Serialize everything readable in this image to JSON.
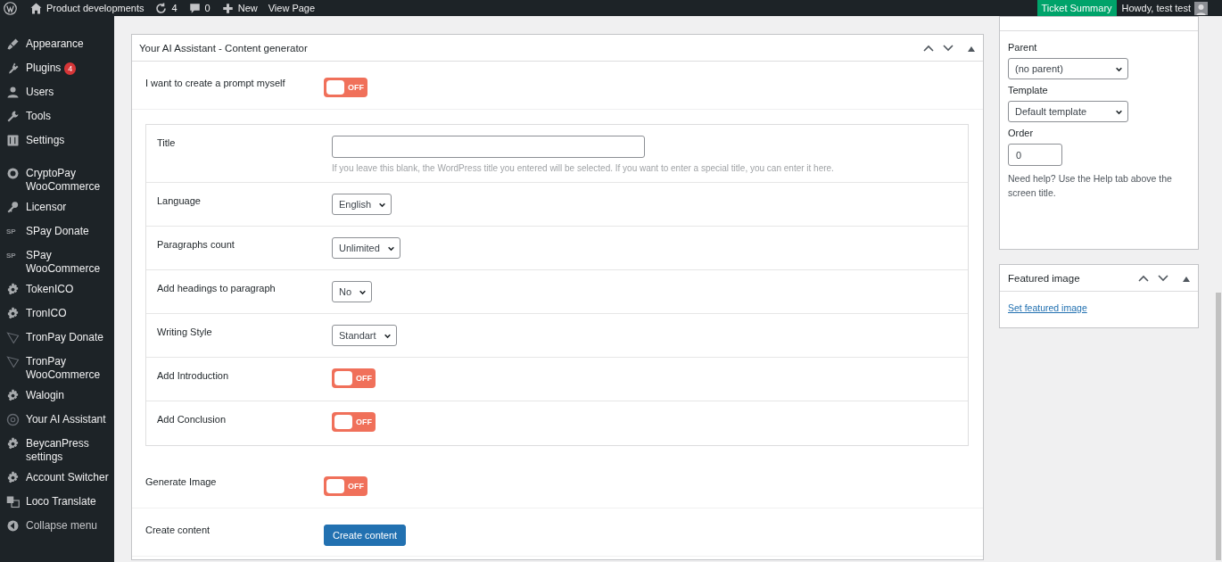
{
  "admin_bar": {
    "site": "Product developments",
    "updates": "4",
    "comments": "0",
    "new": "New",
    "view": "View Page",
    "ticket": "Ticket Summary",
    "howdy": "Howdy, test test"
  },
  "sidebar": {
    "items": [
      {
        "label": "Appearance"
      },
      {
        "label": "Plugins",
        "badge": "4"
      },
      {
        "label": "Users"
      },
      {
        "label": "Tools"
      },
      {
        "label": "Settings"
      },
      {
        "label": "CryptoPay WooCommerce"
      },
      {
        "label": "Licensor"
      },
      {
        "label": "SPay Donate",
        "icon_text": "SP"
      },
      {
        "label": "SPay WooCommerce",
        "icon_text": "SP"
      },
      {
        "label": "TokenICO"
      },
      {
        "label": "TronICO"
      },
      {
        "label": "TronPay Donate"
      },
      {
        "label": "TronPay WooCommerce"
      },
      {
        "label": "Walogin"
      },
      {
        "label": "Your AI Assistant"
      },
      {
        "label": "BeycanPress settings"
      },
      {
        "label": "Account Switcher"
      },
      {
        "label": "Loco Translate"
      }
    ],
    "collapse": "Collapse menu"
  },
  "generator": {
    "title": "Your AI Assistant - Content generator",
    "prompt_row": {
      "label": "I want to create a prompt myself",
      "kind": "toggle",
      "on": false,
      "toggle_label": "OFF"
    },
    "fields": [
      {
        "label": "Title",
        "kind": "text",
        "hint": "If you leave this blank, the WordPress title you entered will be selected. If you want to enter a special title, you can enter it here."
      },
      {
        "label": "Language",
        "kind": "select",
        "value": "English"
      },
      {
        "label": "Paragraphs count",
        "kind": "select",
        "value": "Unlimited"
      },
      {
        "label": "Add headings to paragraph",
        "kind": "select",
        "value": "No"
      },
      {
        "label": "Writing Style",
        "kind": "select",
        "value": "Standart"
      },
      {
        "label": "Add Introduction",
        "kind": "toggle",
        "on": false,
        "toggle_label": "OFF"
      },
      {
        "label": "Add Conclusion",
        "kind": "toggle",
        "on": false,
        "toggle_label": "OFF"
      }
    ],
    "bottom_rows": [
      {
        "label": "Generate Image",
        "kind": "toggle",
        "on": false,
        "toggle_label": "OFF"
      },
      {
        "label": "Create content",
        "kind": "button",
        "button": "Create content"
      }
    ]
  },
  "page_attributes": {
    "parent_label": "Parent",
    "parent": "(no parent)",
    "template_label": "Template",
    "template": "Default template",
    "order_label": "Order",
    "order": "0",
    "help": "Need help? Use the Help tab above the screen title."
  },
  "featured_image": {
    "title": "Featured image",
    "link": "Set featured image"
  }
}
